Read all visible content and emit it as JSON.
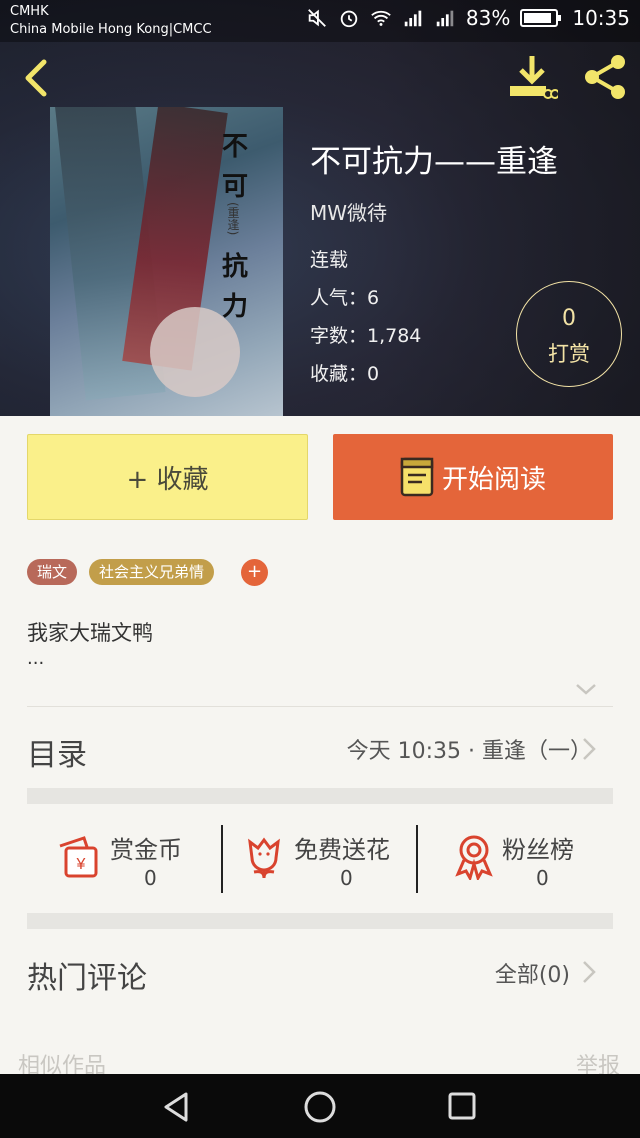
{
  "status_bar": {
    "carrier_line1": "CMHK",
    "carrier_line2": "China Mobile Hong Kong|CMCC",
    "battery": "83%",
    "time": "10:35"
  },
  "book": {
    "title": "不可抗力——重逢",
    "author": "MW微待",
    "status": "连载",
    "popularity": "人气：6",
    "word_count": "字数：1,784",
    "favorites": "收藏：0",
    "cover_title": [
      "不",
      "可",
      "抗",
      "力"
    ],
    "cover_subtitle": "(重逢)"
  },
  "tip": {
    "count": "0",
    "label": "打赏"
  },
  "actions": {
    "collect_label": "+ 收藏",
    "read_label": "开始阅读"
  },
  "tags": [
    "瑞文",
    "社会主义兄弟情"
  ],
  "tag_add": "+",
  "description": {
    "text": "我家大瑞文鸭",
    "ellipsis": "..."
  },
  "toc": {
    "label": "目录",
    "latest": "今天 10:35 · 重逢（一）"
  },
  "stats": [
    {
      "label": "赏金币",
      "value": "0",
      "icon": "red-envelope-icon"
    },
    {
      "label": "免费送花",
      "value": "0",
      "icon": "flower-icon"
    },
    {
      "label": "粉丝榜",
      "value": "0",
      "icon": "medal-icon"
    }
  ],
  "comments": {
    "label": "热门评论",
    "all": "全部(0)"
  },
  "footer": {
    "similar": "相似作品",
    "report": "举报"
  },
  "colors": {
    "accent_orange": "#e4653a",
    "collect_yellow": "#faf08a",
    "icon_red": "#d9432e",
    "header_icon_yellow": "#f2e56a"
  }
}
